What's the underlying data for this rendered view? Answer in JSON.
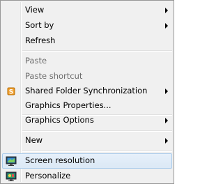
{
  "menu": {
    "view": "View",
    "sort_by": "Sort by",
    "refresh": "Refresh",
    "paste": "Paste",
    "paste_shortcut": "Paste shortcut",
    "shared_folder_sync": "Shared Folder Synchronization",
    "graphics_properties": "Graphics Properties...",
    "graphics_options": "Graphics Options",
    "new": "New",
    "screen_resolution": "Screen resolution",
    "personalize": "Personalize"
  },
  "icons": {
    "shared_folder_sync": "shared-folder-sync-icon",
    "screen_resolution": "monitor-icon",
    "personalize": "personalize-monitor-icon"
  },
  "colors": {
    "menu_bg": "#f0f0f0",
    "hover_bg": "#dbe8f5",
    "hover_border": "#a9cbeb",
    "disabled_text": "#6d6d6d"
  }
}
